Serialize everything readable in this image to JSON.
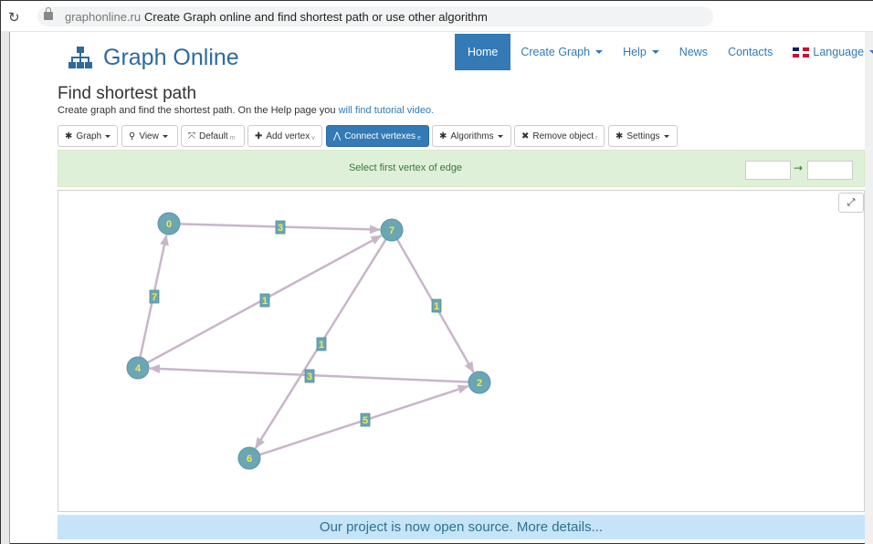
{
  "browser": {
    "domain": "graphonline.ru",
    "tab_title": "Create Graph online and find shortest path or use other algorithm"
  },
  "site": {
    "logo_text": "Graph Online",
    "nav": [
      {
        "label": "Home",
        "active": true
      },
      {
        "label": "Create Graph"
      },
      {
        "label": "Help"
      },
      {
        "label": "News"
      },
      {
        "label": "Contacts"
      },
      {
        "label": "Language"
      }
    ]
  },
  "page": {
    "title": "Find shortest path",
    "subtitle": "Create graph and find the shortest path. On the Help page you ",
    "subtitle_link": "will find tutorial video."
  },
  "toolbar": {
    "graph": "Graph",
    "view": "View",
    "default": "Default",
    "default_hotkey": "m",
    "add_vertex": "Add vertex",
    "add_vertex_hotkey": "v",
    "connect_vertexes": "Connect vertexes",
    "connect_vertexes_hotkey": "e",
    "algorithms": "Algorithms",
    "remove_object": "Remove object",
    "remove_object_hotkey": "r",
    "settings": "Settings"
  },
  "alert": {
    "message": "Select first vertex of edge",
    "arrow": "→"
  },
  "banner": {
    "text": "Our project is now open source. More details..."
  },
  "colors": {
    "vertex_fill": "#6aa6b3",
    "vertex_label": "#f5e94a",
    "edge": "#c8b6c8",
    "weight_bg": "#6aa6b3",
    "weight_text": "#f5e94a",
    "brand": "#337ab7"
  },
  "graph": {
    "vertices": [
      "0",
      "7",
      "4",
      "2",
      "6"
    ],
    "edges": [
      {
        "from": "0",
        "to": "7",
        "weight": "3",
        "directed": true
      },
      {
        "from": "4",
        "to": "0",
        "weight": "7",
        "directed": true
      },
      {
        "from": "4",
        "to": "7",
        "weight": "1",
        "directed": true
      },
      {
        "from": "7",
        "to": "2",
        "weight": "1",
        "directed": true
      },
      {
        "from": "7",
        "to": "6",
        "weight": "1",
        "directed": true
      },
      {
        "from": "2",
        "to": "4",
        "weight": "3",
        "directed": true
      },
      {
        "from": "6",
        "to": "2",
        "weight": "5",
        "directed": true
      }
    ]
  }
}
